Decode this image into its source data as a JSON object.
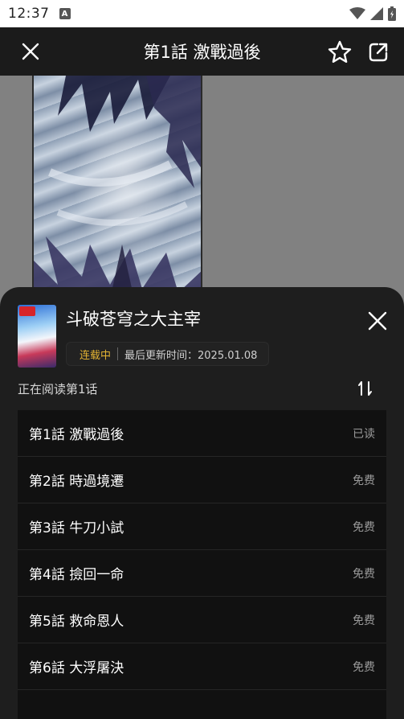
{
  "status_bar": {
    "time": "12:37",
    "notification_icon": "A"
  },
  "top_bar": {
    "title": "第1話 激戰過後",
    "close_icon": "close-icon",
    "favorite_icon": "star-outline-icon",
    "share_icon": "share-external-icon"
  },
  "comic": {
    "title": "斗破苍穹之大主宰",
    "status": "连载中",
    "last_update": "最后更新时间：2025.01.08"
  },
  "reading": {
    "label": "正在阅读第1话"
  },
  "chapters": [
    {
      "name": "第1話 激戰過後",
      "tag": "已读"
    },
    {
      "name": "第2話 時過境遷",
      "tag": "免费"
    },
    {
      "name": "第3話 牛刀小試",
      "tag": "免费"
    },
    {
      "name": "第4話 撿回一命",
      "tag": "免费"
    },
    {
      "name": "第5話 救命恩人",
      "tag": "免费"
    },
    {
      "name": "第6話 大浮屠決",
      "tag": "免费"
    }
  ],
  "colors": {
    "accent_status": "#e2b233",
    "sheet_bg": "#1e1e1e",
    "list_bg": "#111111"
  }
}
